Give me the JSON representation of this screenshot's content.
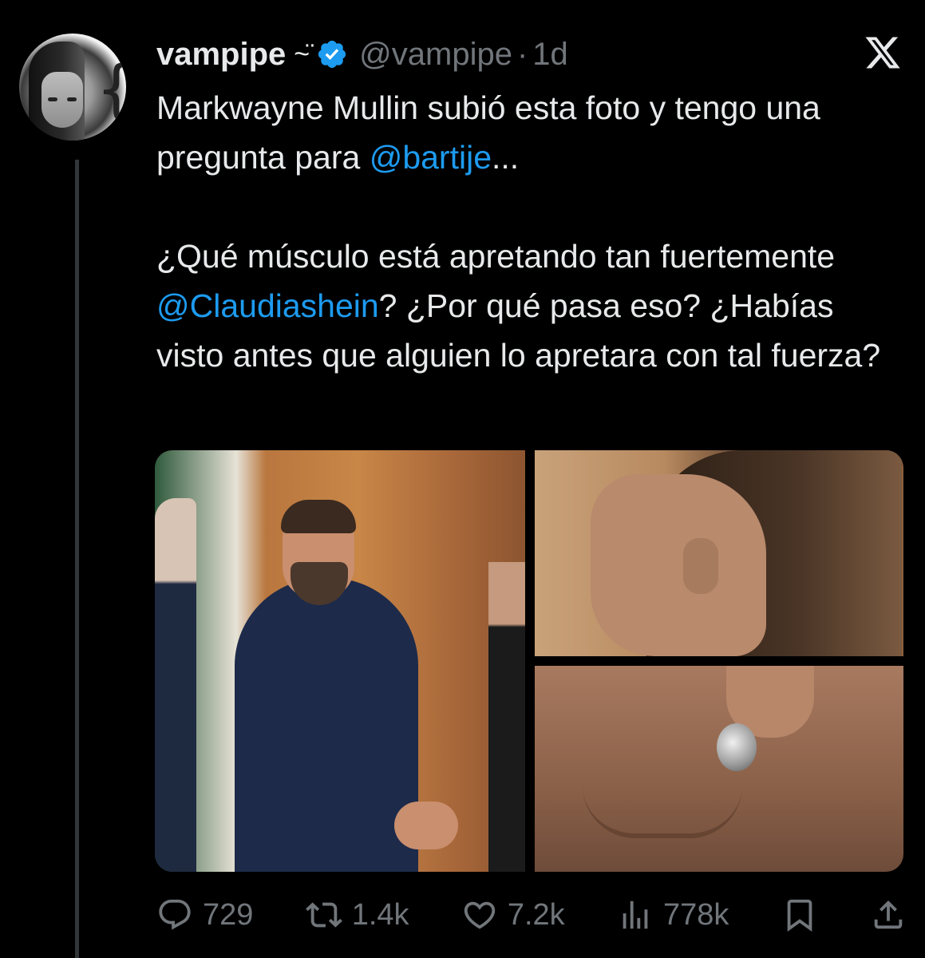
{
  "tweet": {
    "display_name": "vampipe",
    "name_decoration": "~̈",
    "handle": "@vampipe",
    "separator": "·",
    "time": "1d",
    "text": {
      "line1_before": "Markwayne Mullin subió esta foto y tengo una pregunta para ",
      "mention1": "@bartije",
      "line1_after": "...",
      "line2_before": "¿Qué músculo está apretando tan fuertemente ",
      "mention2": "@Claudiashein",
      "line2_after": "? ¿Por qué pasa eso? ¿Habías visto antes que alguien lo apretara con tal fuerza?"
    },
    "media": {
      "count": 3
    },
    "metrics": {
      "replies": "729",
      "reposts": "1.4k",
      "likes": "7.2k",
      "views": "778k"
    }
  },
  "colors": {
    "background": "#000000",
    "text": "#e7e9ea",
    "secondary": "#71767b",
    "link": "#1d9bf0",
    "verified": "#1d9bf0"
  },
  "icons": [
    "x-logo-icon",
    "verified-badge-icon",
    "reply-icon",
    "repost-icon",
    "like-icon",
    "views-icon",
    "bookmark-icon",
    "share-icon"
  ]
}
